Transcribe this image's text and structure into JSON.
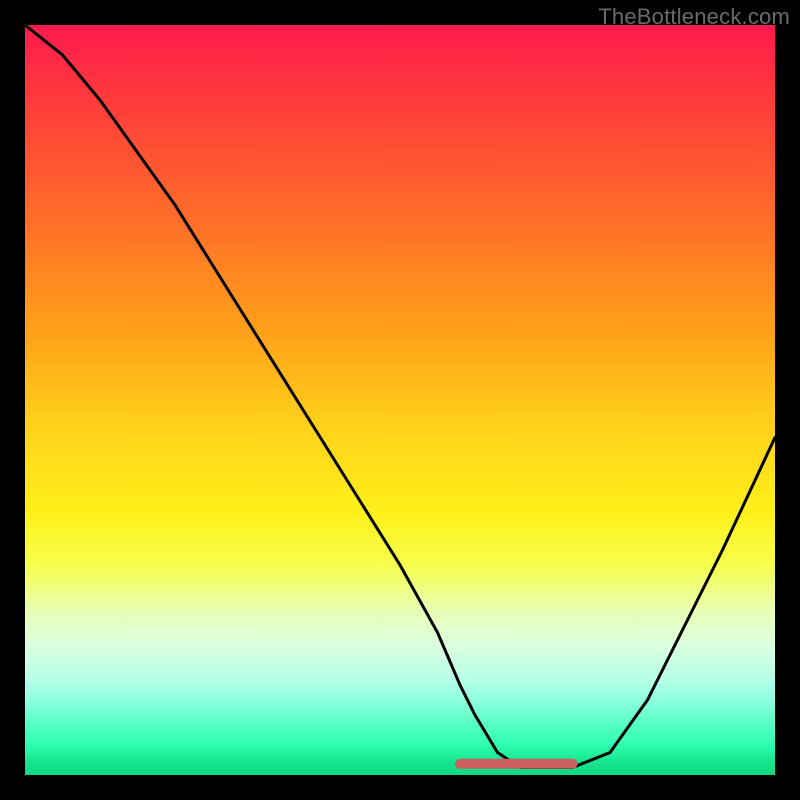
{
  "watermark": "TheBottleneck.com",
  "colors": {
    "background": "#000000",
    "curve": "#000000",
    "marker": "#cc5f5f",
    "gradient_top": "#ff1a4d",
    "gradient_bottom": "#0fd880"
  },
  "chart_data": {
    "type": "line",
    "title": "",
    "xlabel": "",
    "ylabel": "",
    "xlim": [
      0,
      100
    ],
    "ylim": [
      0,
      100
    ],
    "grid": false,
    "legend": false,
    "series": [
      {
        "name": "bottleneck-curve",
        "x": [
          0,
          5,
          10,
          15,
          20,
          25,
          30,
          35,
          40,
          45,
          50,
          55,
          58,
          60,
          63,
          66,
          70,
          73,
          78,
          83,
          88,
          93,
          100
        ],
        "values": [
          100,
          96,
          90,
          83,
          76,
          68,
          60,
          52,
          44,
          36,
          28,
          19,
          12,
          8,
          3,
          1,
          1,
          1,
          3,
          10,
          20,
          30,
          45
        ]
      }
    ],
    "annotations": [
      {
        "name": "optimal-range-marker",
        "type": "segment",
        "x_start": 58,
        "x_end": 73,
        "y": 1.5,
        "color": "#cc5f5f"
      }
    ]
  }
}
